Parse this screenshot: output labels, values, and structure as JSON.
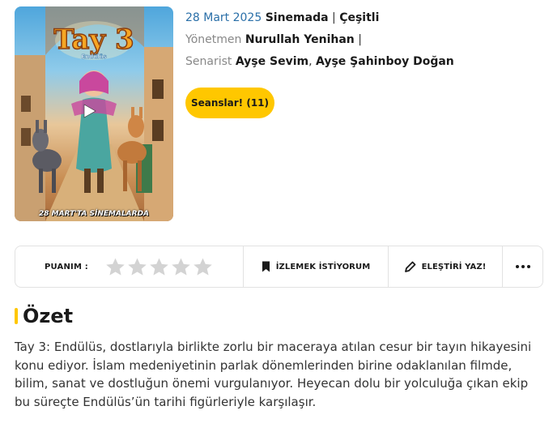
{
  "poster": {
    "title_art": "Tay 3",
    "subtitle_art": "Endülüs",
    "caption": "28 MART'TA SİNEMALARDA"
  },
  "meta": {
    "date": "28 Mart 2025",
    "status": "Sinemada",
    "genre": "Çeşitli",
    "director_label": "Yönetmen",
    "director": "Nurullah Yenihan",
    "writer_label": "Senarist",
    "writer_1": "Ayşe Sevim",
    "writer_2": "Ayşe Şahinboy Doğan"
  },
  "sessions_button": "Seanslar! (11)",
  "actions": {
    "rating_label": "PUANIM :",
    "stars_filled": 0,
    "stars_total": 5,
    "watchlist_label": "İZLEMEK İSTİYORUM",
    "review_label": "ELEŞTİRİ YAZ!"
  },
  "summary": {
    "heading": "Özet",
    "text": "Tay 3: Endülüs, dostlarıyla birlikte zorlu bir maceraya atılan cesur bir tayın hikayesini konu ediyor. İslam medeniyetinin parlak dönemlerinden birine odaklanılan filmde, bilim, sanat ve dostluğun önemi vurgulanıyor. Heyecan dolu bir yolculuğa çıkan ekip bu süreçte Endülüs’ün tarihi figürleriyle karşılaşır."
  },
  "colors": {
    "accent": "#ffc700",
    "date_blue": "#2a6fa8",
    "star_empty": "#d3d3d3"
  }
}
